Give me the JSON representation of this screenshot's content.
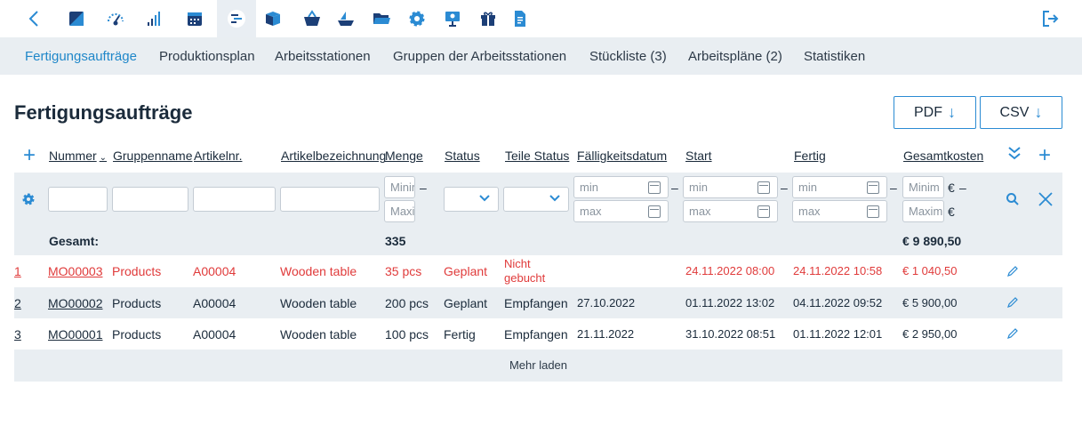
{
  "toolbar": {
    "icons": [
      "back-icon",
      "dashboard-icon",
      "speedometer-icon",
      "bar-chart-icon",
      "calendar-icon",
      "manufacturing-icon",
      "box-icon",
      "basket-icon",
      "ship-icon",
      "folder-icon",
      "settings-icon",
      "presentation-icon",
      "gift-icon",
      "document-icon",
      "logout-icon"
    ],
    "active": "manufacturing-icon"
  },
  "tabs": [
    "Fertigungsaufträge",
    "Produktionsplan",
    "Arbeitsstationen",
    "Gruppen der Arbeitsstationen",
    "Stückliste (3)",
    "Arbeitspläne (2)",
    "Statistiken"
  ],
  "page": {
    "title": "Fertigungsaufträge",
    "pdf_label": "PDF",
    "csv_label": "CSV"
  },
  "columns": {
    "nummer": "Nummer",
    "gruppenname": "Gruppenname",
    "artikelnr": "Artikelnr.",
    "artikelbezeichnung": "Artikelbezeichnung",
    "menge": "Menge",
    "status": "Status",
    "teile_status": "Teile Status",
    "faelligkeitsdatum": "Fälligkeitsdatum",
    "start": "Start",
    "fertig": "Fertig",
    "gesamtkosten": "Gesamtkosten"
  },
  "filters": {
    "menge_min_placeholder": "Minir",
    "menge_max_placeholder": "Maxi",
    "date_min_placeholder": "min",
    "date_max_placeholder": "max",
    "kosten_min_placeholder": "Minim",
    "kosten_max_placeholder": "Maxim",
    "currency": "€",
    "dash": "–"
  },
  "totals": {
    "label": "Gesamt:",
    "menge": "335",
    "gesamtkosten": "€ 9 890,50"
  },
  "rows": [
    {
      "idx": "1",
      "nummer": "MO00003",
      "gruppe": "Products",
      "artikelnr": "A00004",
      "bezeichnung": "Wooden table",
      "menge": "35 pcs",
      "status": "Geplant",
      "teile_status_1": "Nicht",
      "teile_status_2": "gebucht",
      "faellig": "",
      "start": "24.11.2022 08:00",
      "fertig": "24.11.2022 10:58",
      "kosten": "€ 1 040,50"
    },
    {
      "idx": "2",
      "nummer": "MO00002",
      "gruppe": "Products",
      "artikelnr": "A00004",
      "bezeichnung": "Wooden table",
      "menge": "200 pcs",
      "status": "Geplant",
      "teile_status": "Empfangen",
      "faellig": "27.10.2022",
      "start": "01.11.2022 13:02",
      "fertig": "04.11.2022 09:52",
      "kosten": "€ 5 900,00"
    },
    {
      "idx": "3",
      "nummer": "MO00001",
      "gruppe": "Products",
      "artikelnr": "A00004",
      "bezeichnung": "Wooden table",
      "menge": "100 pcs",
      "status": "Fertig",
      "teile_status": "Empfangen",
      "faellig": "21.11.2022",
      "start": "31.10.2022 08:51",
      "fertig": "01.11.2022 12:01",
      "kosten": "€ 2 950,00"
    }
  ],
  "more_label": "Mehr laden",
  "colors": {
    "accent": "#2b8bd3",
    "overdue": "#e03b3b",
    "band": "#e9eef2"
  }
}
